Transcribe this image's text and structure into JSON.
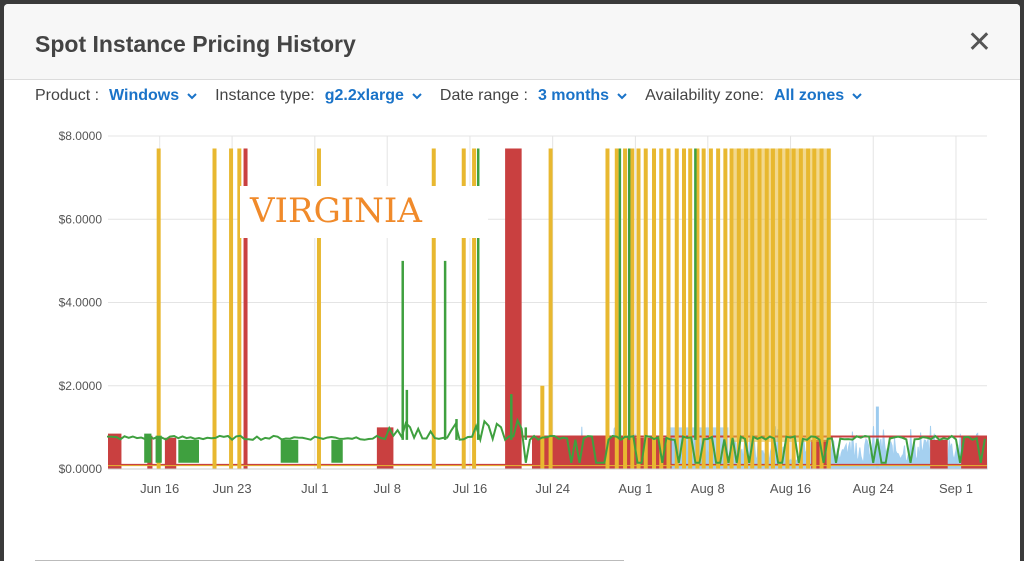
{
  "modal": {
    "title": "Spot Instance Pricing History",
    "close_label": "✕"
  },
  "filters": [
    {
      "label": "Product :",
      "value": "Windows"
    },
    {
      "label": "Instance type:",
      "value": "g2.2xlarge"
    },
    {
      "label": "Date range :",
      "value": "3 months"
    },
    {
      "label": "Availability zone:",
      "value": "All zones"
    }
  ],
  "colors": {
    "yellow": "#e8b830",
    "red": "#c94040",
    "green": "#3fa03f",
    "lightblue": "#9ccbef",
    "grid": "#e4e4e4",
    "axis_text": "#555555",
    "accent": "#1a73c8"
  },
  "chart_data": {
    "type": "line",
    "annotation": "VIRGINIA",
    "ylim": [
      0,
      8
    ],
    "yticks": [
      "$0.0000",
      "$2.0000",
      "$4.0000",
      "$6.0000",
      "$8.0000"
    ],
    "ytick_values": [
      0,
      2,
      4,
      6,
      8
    ],
    "x_tick_labels": [
      "Jun 16",
      "Jun 23",
      "Jul 1",
      "Jul 8",
      "Jul 16",
      "Jul 24",
      "Aug 1",
      "Aug 8",
      "Aug 16",
      "Aug 24",
      "Sep 1"
    ],
    "x_tick_days": [
      5,
      12,
      20,
      27,
      35,
      43,
      51,
      58,
      66,
      74,
      82
    ],
    "x_range_days": [
      0,
      85
    ],
    "x_start_label": "Jun 11",
    "series": [
      {
        "color_key": "yellow",
        "baseline": 0.08,
        "spikes": [
          [
            4.9,
            7.7
          ],
          [
            10.3,
            7.7
          ],
          [
            11.9,
            7.7
          ],
          [
            12.7,
            7.7
          ],
          [
            20.4,
            7.7
          ],
          [
            31.5,
            7.7
          ],
          [
            34.4,
            7.7
          ],
          [
            35.4,
            7.7
          ],
          [
            42.0,
            2.0
          ],
          [
            42.8,
            7.7
          ],
          [
            48.3,
            7.7
          ],
          [
            49.2,
            7.7
          ],
          [
            50.0,
            7.7
          ],
          [
            50.7,
            7.7
          ],
          [
            51.3,
            7.7
          ],
          [
            52.0,
            7.7
          ],
          [
            52.8,
            7.7
          ],
          [
            53.5,
            7.7
          ],
          [
            54.2,
            7.7
          ],
          [
            55.0,
            7.7
          ],
          [
            55.7,
            7.7
          ],
          [
            56.3,
            7.7
          ],
          [
            57.0,
            7.7
          ],
          [
            57.6,
            7.7
          ],
          [
            58.3,
            7.7
          ],
          [
            59.0,
            7.7
          ],
          [
            59.7,
            7.7
          ],
          [
            60.3,
            7.7
          ],
          [
            61.0,
            7.7
          ],
          [
            61.7,
            7.7
          ],
          [
            62.3,
            7.7
          ],
          [
            63.0,
            7.7
          ],
          [
            63.7,
            7.7
          ],
          [
            64.3,
            7.7
          ],
          [
            65.0,
            7.7
          ],
          [
            65.7,
            7.7
          ],
          [
            66.3,
            7.7
          ],
          [
            67.0,
            7.7
          ],
          [
            67.7,
            7.7
          ],
          [
            68.3,
            7.7
          ],
          [
            69.0,
            7.7
          ],
          [
            69.7,
            7.7
          ]
        ]
      },
      {
        "color_key": "red",
        "baseline": 0.1,
        "blocks": [
          [
            0.0,
            1.3,
            0.85
          ],
          [
            3.8,
            4.3,
            0.8
          ],
          [
            5.5,
            6.6,
            0.75
          ],
          [
            26.0,
            27.6,
            1.0
          ],
          [
            38.4,
            40.0,
            7.7
          ],
          [
            41.0,
            51.0,
            0.8
          ],
          [
            51.0,
            54.5,
            0.75
          ],
          [
            68.0,
            69.5,
            0.7
          ],
          [
            79.5,
            81.2,
            0.7
          ],
          [
            82.5,
            85.0,
            0.8
          ]
        ],
        "spikes": [
          [
            13.3,
            7.7
          ]
        ],
        "upper_level": 0.78
      },
      {
        "color_key": "green",
        "baseline": 0.15,
        "level": 0.75,
        "spikes": [
          [
            28.5,
            5.0
          ],
          [
            28.9,
            1.9
          ],
          [
            32.6,
            5.0
          ],
          [
            33.7,
            1.2
          ],
          [
            35.8,
            7.7
          ],
          [
            39.0,
            1.8
          ],
          [
            40.4,
            1.0
          ],
          [
            49.5,
            7.7
          ],
          [
            50.4,
            7.7
          ],
          [
            56.8,
            7.7
          ]
        ],
        "blocks": [
          [
            3.5,
            4.2,
            0.85
          ],
          [
            4.6,
            5.2,
            0.8
          ],
          [
            6.8,
            8.8,
            0.7
          ],
          [
            16.7,
            18.4,
            0.7
          ],
          [
            21.6,
            22.7,
            0.7
          ]
        ]
      },
      {
        "color_key": "lightblue",
        "baseline": 0.15,
        "noise_start": 44.5,
        "noise_end": 85.0,
        "level": 0.6,
        "spikes": [
          [
            66.3,
            1.6
          ],
          [
            74.4,
            1.5
          ]
        ]
      }
    ]
  }
}
